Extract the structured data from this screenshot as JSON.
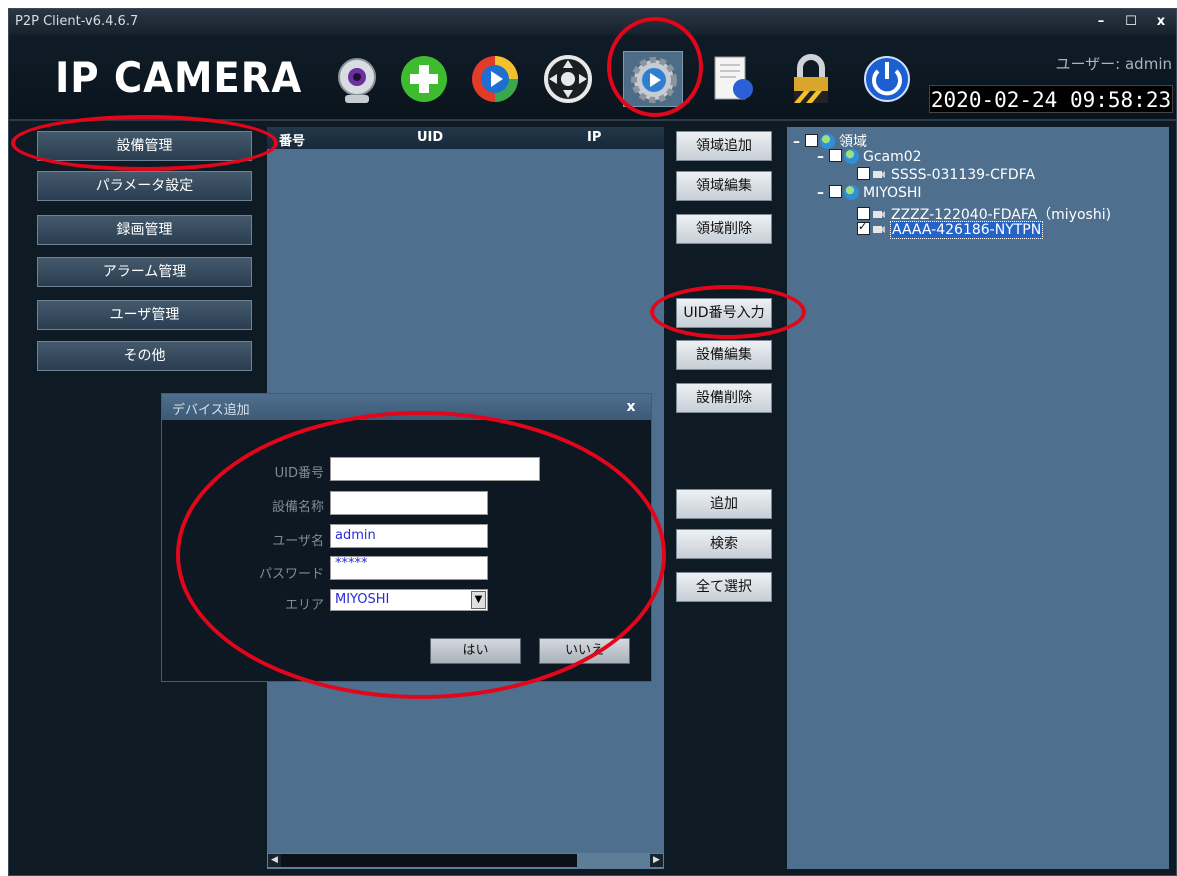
{
  "window": {
    "title": "P2P Client-v6.4.6.7",
    "minimize": "–",
    "maximize": "☐",
    "close": "x"
  },
  "header": {
    "logo": "IP CAMERA",
    "user_label": "ユーザー: admin",
    "datetime": "2020-02-24 09:58:23",
    "tools": [
      "camera-icon",
      "add-icon",
      "playback-icon",
      "ptz-icon",
      "settings-icon",
      "log-icon",
      "lock-icon",
      "power-icon"
    ]
  },
  "nav": {
    "items": [
      {
        "label": "設備管理"
      },
      {
        "label": "パラメータ設定"
      },
      {
        "label": "録画管理"
      },
      {
        "label": "アラーム管理"
      },
      {
        "label": "ユーザ管理"
      },
      {
        "label": "その他"
      }
    ]
  },
  "device_list": {
    "columns": [
      "番号",
      "UID",
      "IP"
    ]
  },
  "middle_buttons": {
    "area_add": "領域追加",
    "area_edit": "領域編集",
    "area_delete": "領域削除",
    "uid_input": "UID番号入力",
    "device_edit": "設備編集",
    "device_delete": "設備削除",
    "add": "追加",
    "search": "検索",
    "select_all": "全て選択"
  },
  "tree": {
    "root": "領域",
    "group1": "Gcam02",
    "dev1": "SSSS-031139-CFDFA",
    "group2": "MIYOSHI",
    "dev2": "ZZZZ-122040-FDAFA（miyoshi)",
    "dev3": "AAAA-426186-NYTPN",
    "expander": "–"
  },
  "dialog": {
    "title": "デバイス追加",
    "close": "x",
    "uid_label": "UID番号",
    "uid_value": "",
    "name_label": "設備名称",
    "name_value": "",
    "user_label": "ユーザ名",
    "user_value": "admin",
    "pass_label": "パスワード",
    "pass_value": "*****",
    "area_label": "エリア",
    "area_value": "MIYOSHI",
    "ok": "はい",
    "cancel": "いいえ"
  },
  "colors": {
    "annotation": "#e3061b",
    "panel": "#4e6f8e",
    "background": "#0e1a24"
  }
}
